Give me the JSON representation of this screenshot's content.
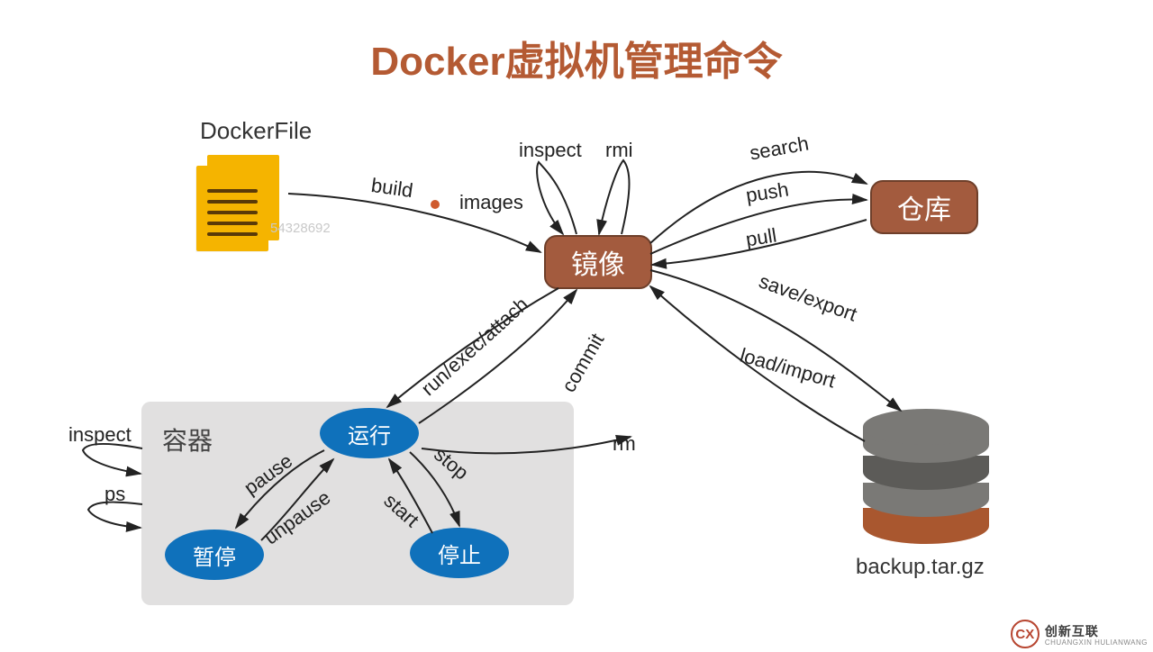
{
  "title": "Docker虚拟机管理命令",
  "dockerfile_label": "DockerFile",
  "watermark": "54328692",
  "nodes": {
    "image": "镜像",
    "repo": "仓库"
  },
  "container": {
    "label": "容器",
    "states": {
      "run": "运行",
      "pause": "暂停",
      "stop": "停止"
    }
  },
  "db_label": "backup.tar.gz",
  "edges": {
    "build": "build",
    "inspect_top": "inspect",
    "rmi": "rmi",
    "images": "images",
    "search": "search",
    "push": "push",
    "pull": "pull",
    "save_export": "save/export",
    "load_import": "load/import",
    "run_exec_attach": "run/exec/attach",
    "commit": "commit",
    "rm": "rm",
    "inspect_left": "inspect",
    "ps": "ps",
    "pause": "pause",
    "unpause": "unpause",
    "stop": "stop",
    "start": "start"
  },
  "brand": {
    "badge": "CX",
    "cn": "创新互联",
    "en": "CHUANGXIN HULIANWANG"
  }
}
